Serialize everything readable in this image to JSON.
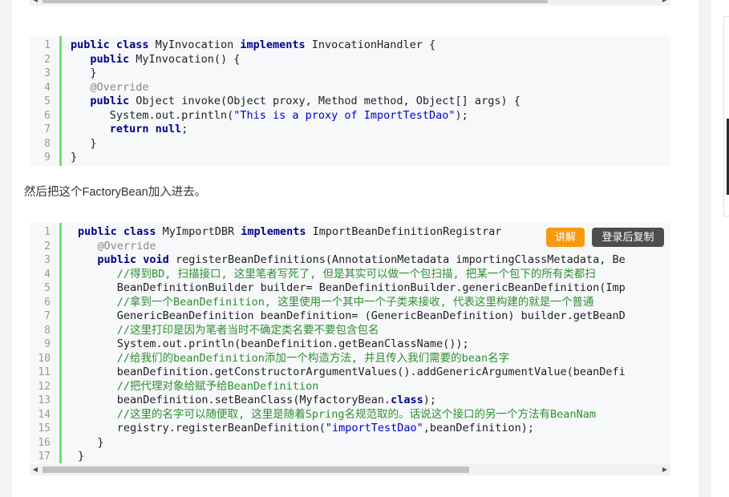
{
  "intro_text": "然后把这个FactoryBean加入进去。",
  "buttons": {
    "explain": "讲解",
    "copy": "登录后复制"
  },
  "scroll_arrows": {
    "left": "◀",
    "right": "▶"
  },
  "code_block_1": {
    "lines": [
      [
        [
          "kw",
          "public class "
        ],
        [
          "tx",
          "MyInvocation "
        ],
        [
          "kw",
          "implements "
        ],
        [
          "tx",
          "InvocationHandler {"
        ]
      ],
      [
        [
          "tx",
          "   "
        ],
        [
          "kw",
          "public "
        ],
        [
          "tx",
          "MyInvocation() {"
        ]
      ],
      [
        [
          "tx",
          "   }"
        ]
      ],
      [
        [
          "tx",
          "   "
        ],
        [
          "an",
          "@Override"
        ]
      ],
      [
        [
          "tx",
          "   "
        ],
        [
          "kw",
          "public "
        ],
        [
          "tx",
          "Object invoke(Object proxy, Method method, Object[] args) {"
        ]
      ],
      [
        [
          "tx",
          "      System.out.println("
        ],
        [
          "st",
          "\"This is a proxy of ImportTestDao\""
        ],
        [
          "tx",
          ");"
        ]
      ],
      [
        [
          "tx",
          "      "
        ],
        [
          "kw",
          "return null"
        ],
        [
          "tx",
          ";"
        ]
      ],
      [
        [
          "tx",
          "   }"
        ]
      ],
      [
        [
          "tx",
          "}"
        ]
      ]
    ]
  },
  "code_block_2": {
    "lines": [
      [
        [
          "kw",
          "public class "
        ],
        [
          "tx",
          "MyImportDBR "
        ],
        [
          "kw",
          "implements "
        ],
        [
          "tx",
          "ImportBeanDefinitionRegistrar"
        ]
      ],
      [
        [
          "tx",
          "   "
        ],
        [
          "an",
          "@Override"
        ]
      ],
      [
        [
          "tx",
          "   "
        ],
        [
          "kw",
          "public void "
        ],
        [
          "tx",
          "registerBeanDefinitions(AnnotationMetadata importingClassMetadata, Be"
        ]
      ],
      [
        [
          "tx",
          "      "
        ],
        [
          "cm",
          "//得到BD, 扫描接口, 这里笔者写死了, 但是其实可以做一个包扫描, 把某一个包下的所有类都扫"
        ]
      ],
      [
        [
          "tx",
          "      BeanDefinitionBuilder builder= BeanDefinitionBuilder.genericBeanDefinition(Imp"
        ]
      ],
      [
        [
          "tx",
          "      "
        ],
        [
          "cm",
          "//拿到一个BeanDefinition, 这里使用一个其中一个子类来接收, 代表这里构建的就是一个普通"
        ]
      ],
      [
        [
          "tx",
          "      GenericBeanDefinition beanDefinition= (GenericBeanDefinition) builder.getBeanD"
        ]
      ],
      [
        [
          "tx",
          "      "
        ],
        [
          "cm",
          "//这里打印是因为笔者当时不确定类名要不要包含包名"
        ]
      ],
      [
        [
          "tx",
          "      System.out.println(beanDefinition.getBeanClassName());"
        ]
      ],
      [
        [
          "tx",
          "      "
        ],
        [
          "cm",
          "//给我们的beanDefinition添加一个构造方法, 并且传入我们需要的bean名字"
        ]
      ],
      [
        [
          "tx",
          "      beanDefinition.getConstructorArgumentValues().addGenericArgumentValue(beanDefi"
        ]
      ],
      [
        [
          "tx",
          "      "
        ],
        [
          "cm",
          "//把代理对象给赋予给BeanDefinition"
        ]
      ],
      [
        [
          "tx",
          "      beanDefinition.setBeanClass(MyfactoryBean."
        ],
        [
          "kw",
          "class"
        ],
        [
          "tx",
          ");"
        ]
      ],
      [
        [
          "tx",
          "      "
        ],
        [
          "cm",
          "//这里的名字可以随便取, 这里是随着Spring名规范取的。话说这个接口的另一个方法有BeanNam"
        ]
      ],
      [
        [
          "tx",
          "      registry.registerBeanDefinition("
        ],
        [
          "st",
          "\"importTestDao\""
        ],
        [
          "tx",
          ",beanDefinition);"
        ]
      ],
      [
        [
          "tx",
          "   }"
        ]
      ],
      [
        [
          "tx",
          "}"
        ]
      ]
    ]
  }
}
